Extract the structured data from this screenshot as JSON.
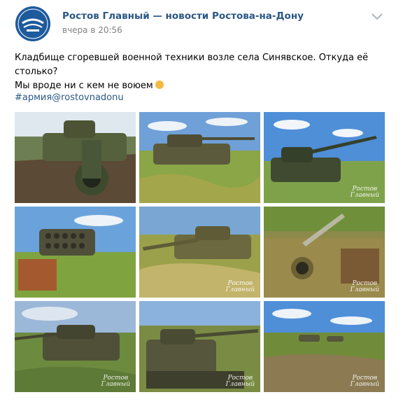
{
  "post": {
    "author": "Ростов Главный — новости Ростова-на-Дону",
    "time": "вчера в 20:56",
    "text_line1": "Кладбище сгоревшей военной техники возле села Синявское. Откуда её столько?",
    "text_line2": "Мы вроде ни с кем не воюем",
    "hashtag": "#армия@rostovnadonu"
  },
  "avatar": {
    "brand_color": "#1e5b9c"
  },
  "icons": {
    "menu": "chevron-down-icon",
    "emoji": "slightly-smiling-face-emoji"
  },
  "colors": {
    "link": "#2a5885",
    "muted": "#828282"
  },
  "photos": [
    {
      "subject": "tank-turret-close",
      "sky": "#dfe7ef",
      "ground": "#6d7f52"
    },
    {
      "subject": "tank-in-grass",
      "sky": "#6fa0d8",
      "ground": "#8aa646"
    },
    {
      "subject": "tank-side-view",
      "sky": "#4f8fd8",
      "ground": "#7ea24a"
    },
    {
      "subject": "rocket-launcher",
      "sky": "#6aa3dc",
      "ground": "#7fa43f"
    },
    {
      "subject": "tank-long-barrel",
      "sky": "#7aa6d4",
      "ground": "#9aa14a"
    },
    {
      "subject": "rusted-tank-closeup",
      "sky": "#c3cfa0",
      "ground": "#8b8a4a"
    },
    {
      "subject": "tank-on-field",
      "sky": "#9cb8d8",
      "ground": "#6c8b3f"
    },
    {
      "subject": "tank-front-barrel",
      "sky": "#8ab2dc",
      "ground": "#7a8c44"
    },
    {
      "subject": "vehicle-row-distance",
      "sky": "#4f8fd8",
      "ground": "#708c3a"
    }
  ]
}
